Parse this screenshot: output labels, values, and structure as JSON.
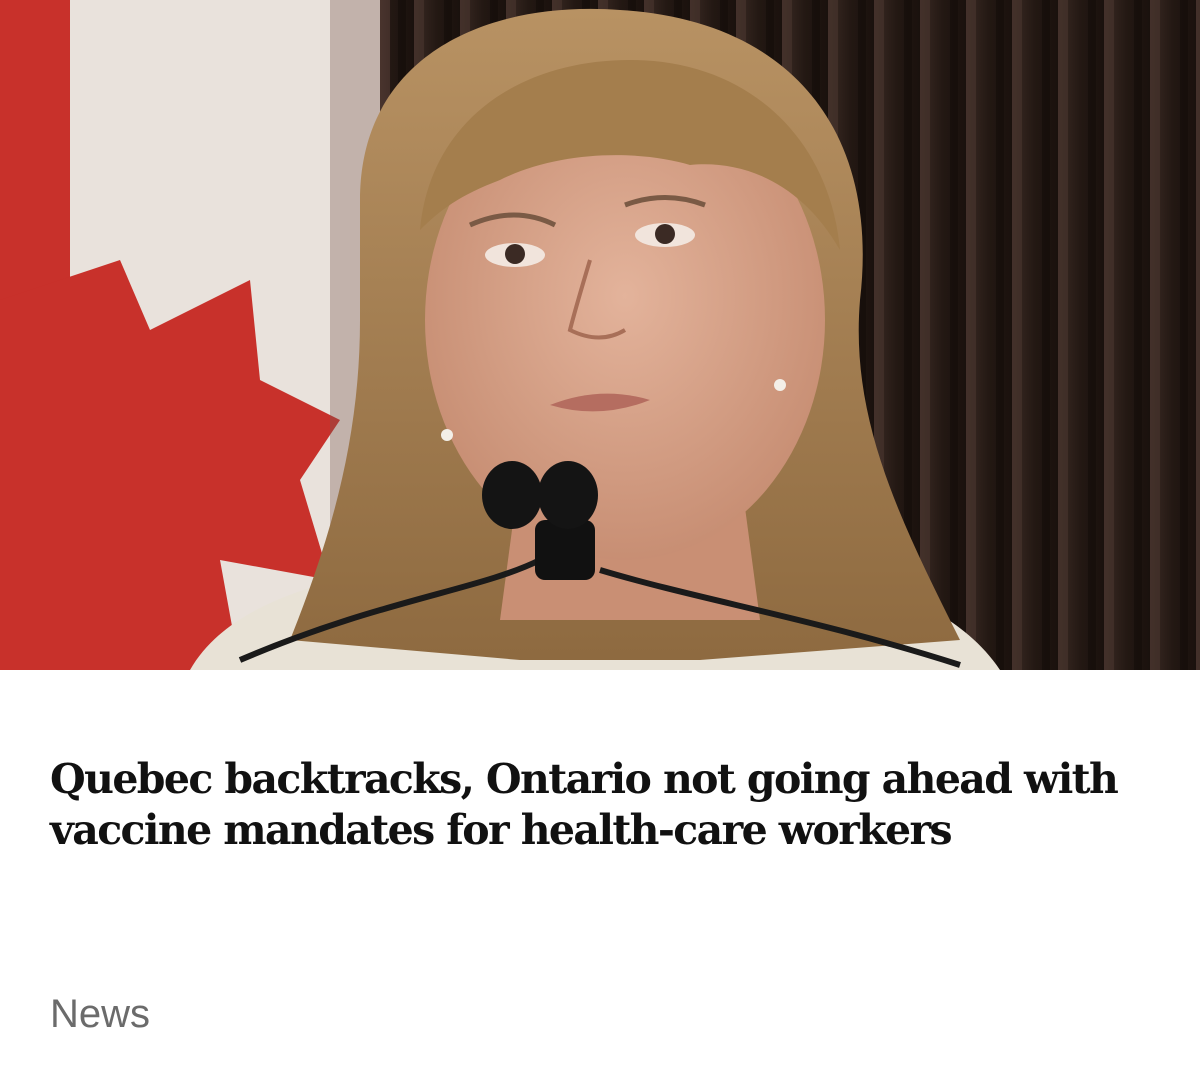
{
  "article": {
    "image": {
      "icon": "news-photo",
      "colors": {
        "backdrop": "#2a1e19",
        "flag_red": "#c8312b",
        "flag_white": "#e9e2dc",
        "hair": "#a47e4d",
        "skin": "#d9a58c"
      }
    },
    "headline": "Quebec backtracks, Ontario not going ahead with vaccine mandates for health-care workers",
    "category": "News"
  }
}
